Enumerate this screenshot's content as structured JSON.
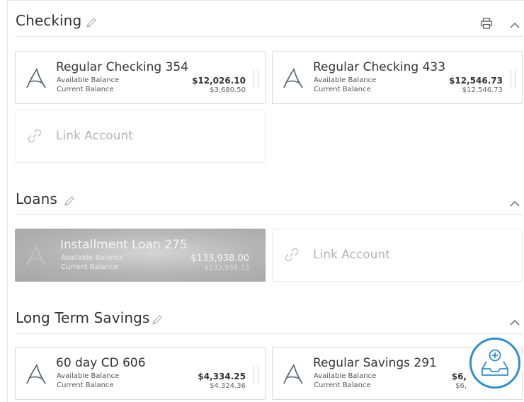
{
  "sections": {
    "checking": {
      "title": "Checking",
      "accounts": [
        {
          "name": "Regular Checking 354",
          "available_label": "Available Balance",
          "current_label": "Current Balance",
          "available": "$12,026.10",
          "current": "$3,680.50"
        },
        {
          "name": "Regular Checking 433",
          "available_label": "Available Balance",
          "current_label": "Current Balance",
          "available": "$12,546.73",
          "current": "$12,546.73"
        }
      ],
      "link_label": "Link Account"
    },
    "loans": {
      "title": "Loans",
      "accounts": [
        {
          "name": "Installment Loan 275",
          "available_label": "Available Balance",
          "current_label": "Current Balance",
          "available": "$133,938.00",
          "current": "$133,938.33"
        }
      ],
      "link_label": "Link Account"
    },
    "savings": {
      "title": "Long Term Savings",
      "accounts": [
        {
          "name": "60 day CD 606",
          "available_label": "Available Balance",
          "current_label": "Current Balance",
          "available": "$4,334.25",
          "current": "$4,324.36"
        },
        {
          "name": "Regular Savings 291",
          "available_label": "Available Balance",
          "current_label": "Current Balance",
          "available": "$6,",
          "current": "$6,"
        }
      ]
    }
  },
  "icons": {
    "edit": "pencil-icon",
    "print": "printer-icon",
    "collapse": "chevron-up-icon",
    "logo": "bank-a-logo-icon",
    "link": "chain-link-icon",
    "fab": "inbox-add-icon"
  },
  "colors": {
    "accent": "#2e8fd0",
    "logo": "#5a6b7a",
    "border": "#d9d9d9",
    "muted_text": "#b5b5b5"
  }
}
